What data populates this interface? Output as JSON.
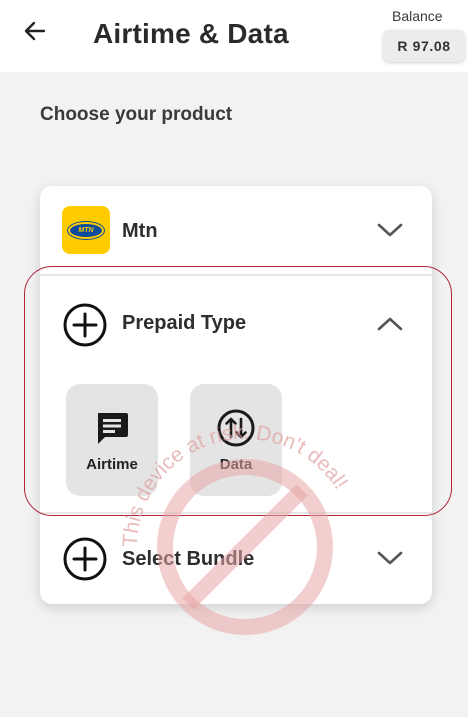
{
  "header": {
    "title": "Airtime & Data",
    "balance_label": "Balance",
    "balance_value": "R 97.08"
  },
  "main": {
    "section_heading": "Choose your product",
    "network": {
      "name": "Mtn",
      "logo_text": "MTN"
    },
    "prepaid": {
      "label": "Prepaid Type",
      "options": [
        {
          "label": "Airtime",
          "icon": "message-icon"
        },
        {
          "label": "Data",
          "icon": "up-down-arrows-icon"
        }
      ]
    },
    "bundle": {
      "label": "Select Bundle"
    }
  },
  "watermark": {
    "text": "This device at risk. Don't deal!"
  },
  "colors": {
    "highlight": "#b0243a",
    "mtn_yellow": "#ffcc00",
    "watermark": "#e0a0a0"
  }
}
